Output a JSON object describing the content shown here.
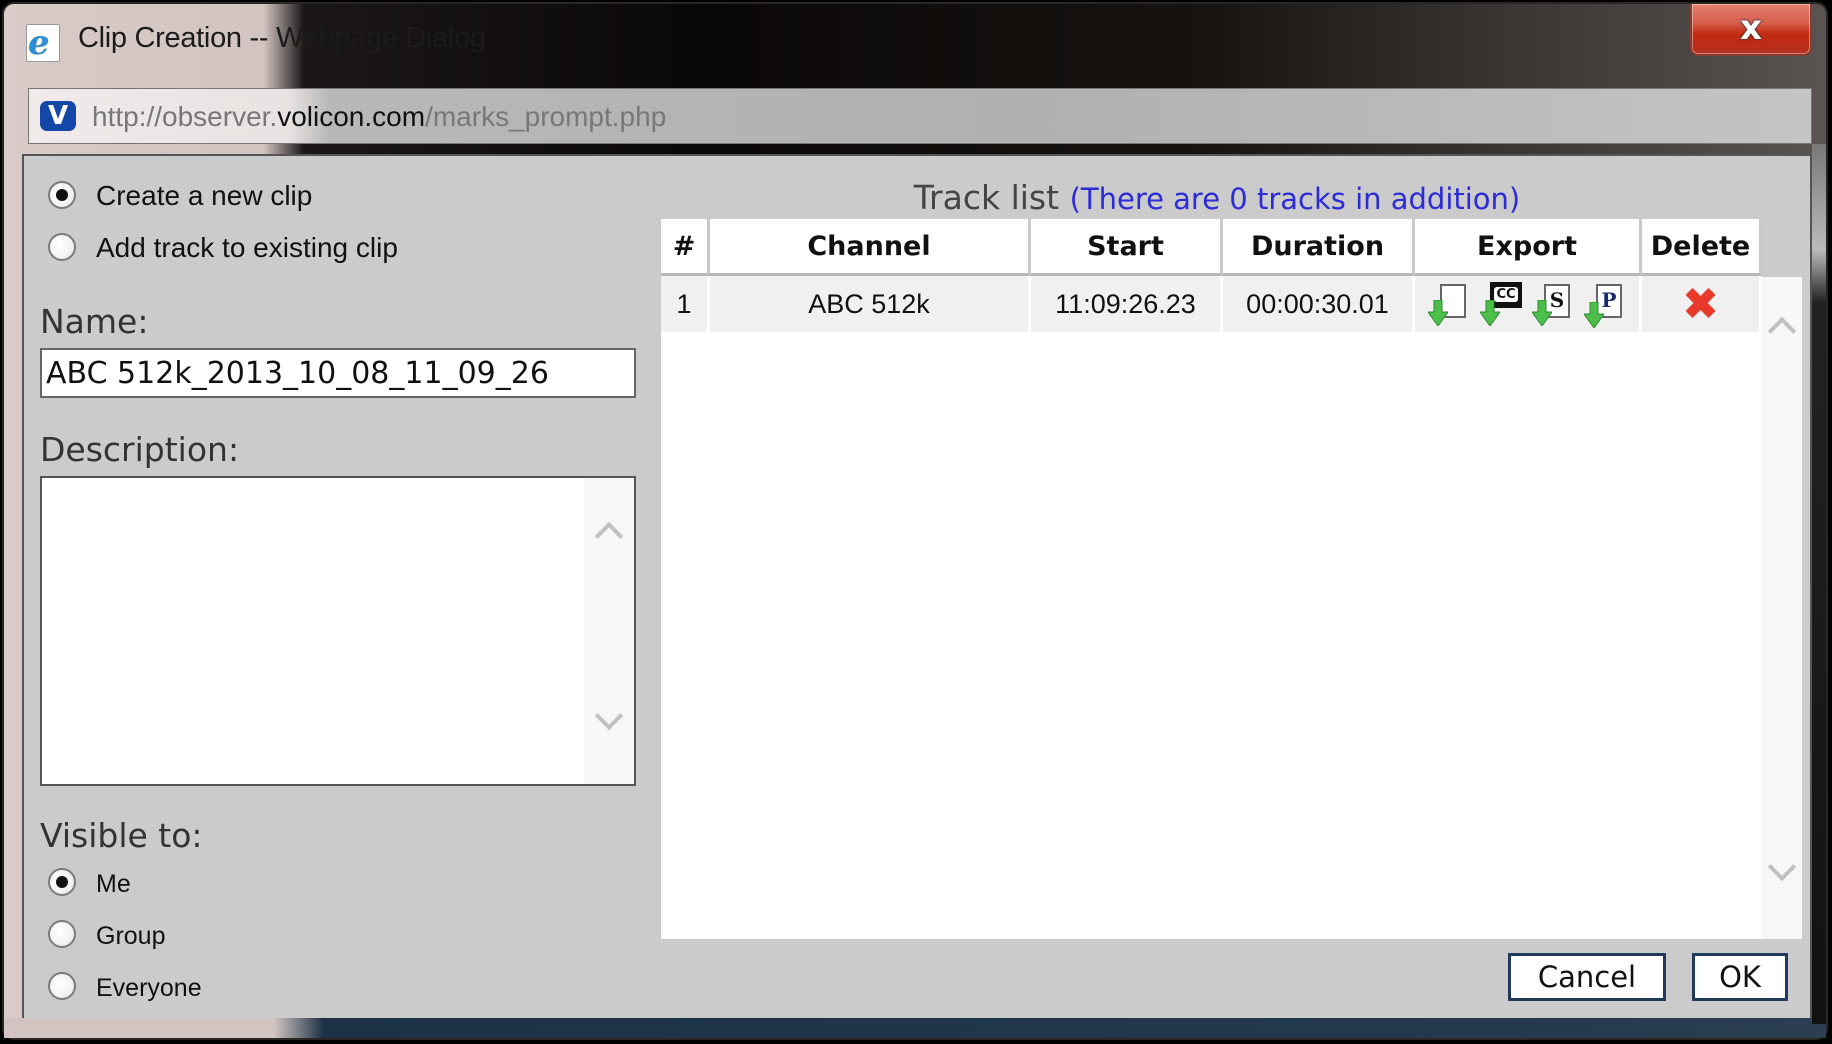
{
  "window": {
    "title": "Clip Creation -- Webpage Dialog",
    "close_label": "x",
    "app_icon": "ie-icon"
  },
  "address": {
    "site_icon_letter": "V",
    "url_prefix": "http://observer.",
    "url_domain": "volicon.com",
    "url_path": "/marks_prompt.php"
  },
  "clip_mode": {
    "options": [
      {
        "label": "Create a new clip",
        "checked": true
      },
      {
        "label": "Add track to existing clip",
        "checked": false
      }
    ]
  },
  "name": {
    "label": "Name:",
    "value": "ABC 512k_2013_10_08_11_09_26"
  },
  "description": {
    "label": "Description:",
    "value": ""
  },
  "visibility": {
    "label": "Visible to:",
    "options": [
      {
        "label": "Me",
        "checked": true
      },
      {
        "label": "Group",
        "checked": false
      },
      {
        "label": "Everyone",
        "checked": false
      }
    ]
  },
  "track_list": {
    "title": "Track list",
    "subtitle": "(There are 0 tracks in addition)",
    "columns": [
      "#",
      "Channel",
      "Start",
      "Duration",
      "Export",
      "Delete"
    ],
    "rows": [
      {
        "index": "1",
        "channel": "ABC 512k",
        "start": "11:09:26.23",
        "duration": "00:00:30.01",
        "export_icons": [
          {
            "name": "export-video-icon",
            "glyph": ""
          },
          {
            "name": "export-cc-icon",
            "glyph": "CC"
          },
          {
            "name": "export-s-icon",
            "glyph": "S"
          },
          {
            "name": "export-p-icon",
            "glyph": "P"
          }
        ],
        "delete_glyph": "✖"
      }
    ]
  },
  "buttons": {
    "cancel": "Cancel",
    "ok": "OK"
  },
  "colors": {
    "accent_link": "#2b2bd8",
    "delete_red": "#e8392a",
    "export_arrow_green": "#4cbf4a",
    "close_red": "#c22a10"
  }
}
